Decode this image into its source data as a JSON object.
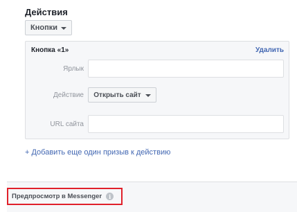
{
  "section": {
    "title": "Действия"
  },
  "buttons_dropdown": {
    "label": "Кнопки",
    "icon": "chevron-down-icon"
  },
  "button_panel": {
    "title": "Кнопка «1»",
    "remove_label": "Удалить",
    "fields": {
      "label": {
        "label": "Ярлык",
        "value": ""
      },
      "action": {
        "label": "Действие",
        "selected": "Открыть сайт"
      },
      "url": {
        "label": "URL сайта",
        "value": ""
      }
    }
  },
  "add_cta_link": "+ Добавить еще один призыв к действию",
  "preview": {
    "label": "Предпросмотр в Messenger",
    "info_icon": "i"
  },
  "colors": {
    "link": "#4267b2",
    "highlight": "#e0202a",
    "panel_bg": "#f6f7f9"
  }
}
